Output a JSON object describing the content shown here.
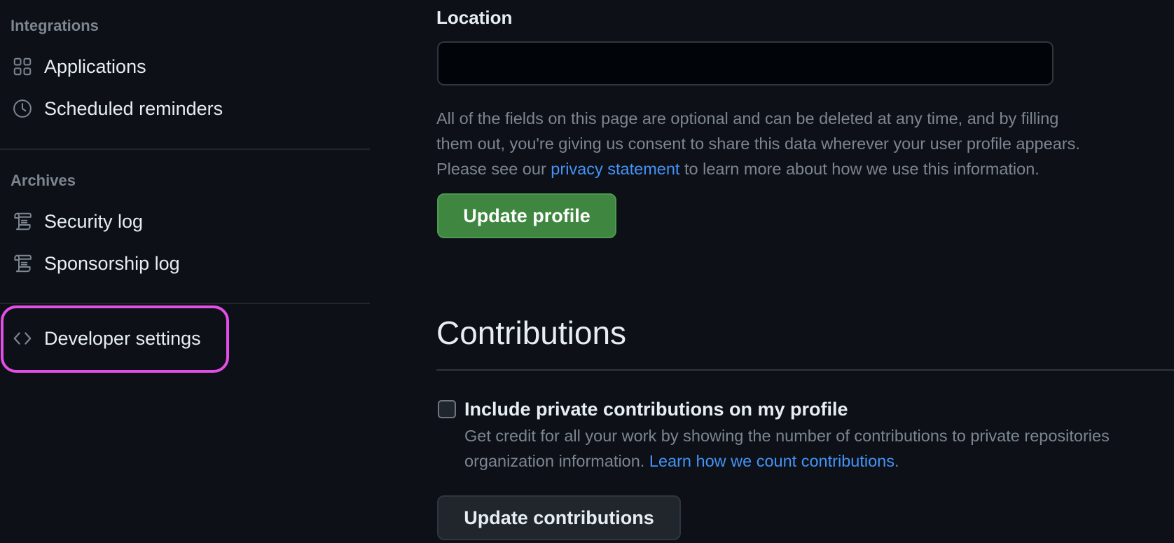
{
  "sidebar": {
    "sections": [
      {
        "heading": "Integrations",
        "items": [
          {
            "label": "Applications",
            "icon": "apps-grid-icon"
          },
          {
            "label": "Scheduled reminders",
            "icon": "clock-icon"
          }
        ]
      },
      {
        "heading": "Archives",
        "items": [
          {
            "label": "Security log",
            "icon": "log-icon"
          },
          {
            "label": "Sponsorship log",
            "icon": "log-icon"
          }
        ]
      },
      {
        "heading": "",
        "items": [
          {
            "label": "Developer settings",
            "icon": "code-icon",
            "highlighted": true
          }
        ]
      }
    ]
  },
  "main": {
    "location": {
      "label": "Location",
      "value": "",
      "placeholder": ""
    },
    "help": {
      "line1": "All of the fields on this page are optional and can be deleted at any time, and by filling",
      "line2": "them out, you're giving us consent to share this data wherever your user profile appears.",
      "line3_before": "Please see our ",
      "link": "privacy statement",
      "line3_after": " to learn more about how we use this information."
    },
    "update_profile_label": "Update profile",
    "contributions": {
      "title": "Contributions",
      "checkbox_label": "Include private contributions on my profile",
      "checked": false,
      "note_line1": "Get credit for all your work by showing the number of contributions to private repositories",
      "note_line2_before": "organization information. ",
      "note_link": "Learn how we count contributions",
      "note_line2_after": ".",
      "button_label": "Update contributions"
    }
  },
  "colors": {
    "background": "#0d1117",
    "primary_button": "#3f8640",
    "link": "#4493f8",
    "highlight_outline": "#e34ee6"
  }
}
